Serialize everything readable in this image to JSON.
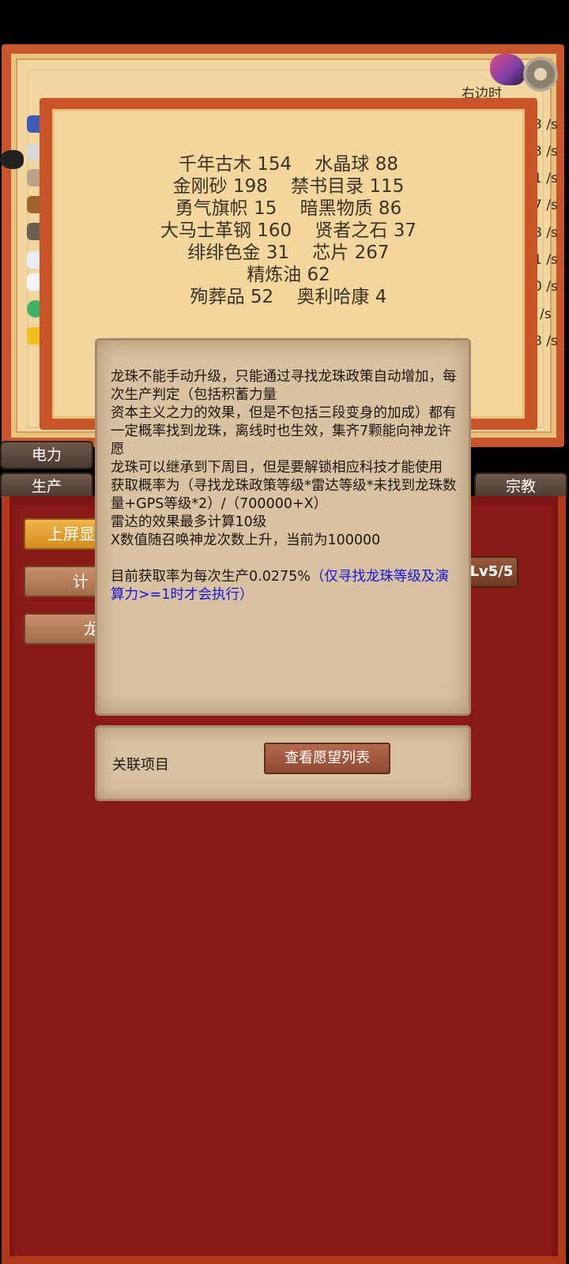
{
  "top_panel": {
    "corner_label": "右边时",
    "rates": [
      "3 /s",
      "3 /s",
      "1 /s",
      "7 /s",
      "8 /s",
      "1 /s",
      "0 /s",
      "/s",
      "8 /s"
    ]
  },
  "resources": {
    "lines": [
      "千年古木 154    水晶球 88",
      "金刚砂 198    禁书目录 115",
      "勇气旗帜 15    暗黑物质 86",
      "大马士革钢 160    贤者之石 37",
      "绯绯色金 31    芯片 267",
      "精炼油 62",
      "殉葬品 52    奥利哈康 4"
    ]
  },
  "side_buttons": {
    "power": "电力",
    "production": "生产",
    "religion": "宗教"
  },
  "main_buttons": {
    "top_display": "上屏显",
    "calc": "计",
    "dragon": "龙",
    "level_badge": "Lv5/5"
  },
  "tooltip": {
    "paragraphs": [
      "龙珠不能手动升级，只能通过寻找龙珠政策自动增加，每次生产判定（包括积蓄力量",
      "资本主义之力的效果，但是不包括三段变身的加成）都有一定概率找到龙珠，离线时也生效，集齐7颗能向神龙许愿",
      "龙珠可以继承到下周目，但是要解锁相应科技才能使用",
      "获取概率为（寻找龙珠政策等级*雷达等级*未找到龙珠数量+GPS等级*2）/（700000+X）",
      "雷达的效果最多计算10级",
      "X数值随召唤神龙次数上升，当前为100000"
    ],
    "current_rate": "目前获取率为每次生产0.0275%",
    "note": "（仅寻找龙珠等级及演算力>=1时才会执行）",
    "related_label": "关联项目",
    "wishlist_button": "查看愿望列表"
  },
  "colors": {
    "red_bg": "#8a1a17",
    "frame_orange": "#c85428",
    "parchment": "#d9c2a2",
    "note_blue": "#1515e0"
  }
}
